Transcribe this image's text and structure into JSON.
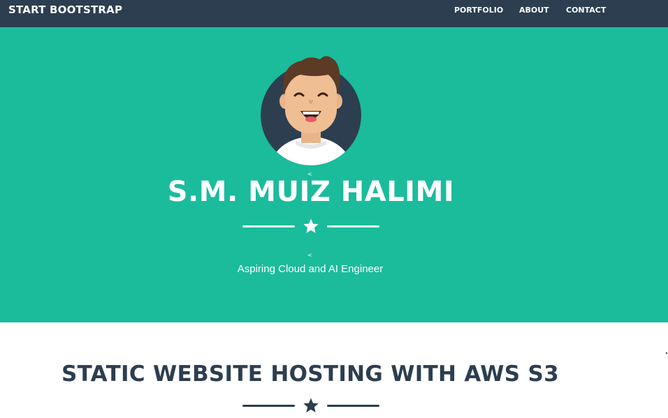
{
  "navbar": {
    "brand": "START BOOTSTRAP",
    "links": [
      {
        "label": "PORTFOLIO"
      },
      {
        "label": "ABOUT"
      },
      {
        "label": "CONTACT"
      }
    ]
  },
  "masthead": {
    "stray_mark": "<",
    "heading": "S.M. MUIZ HALIMI",
    "divider_icon": "star-icon",
    "subheading": "Aspiring Cloud and AI Engineer",
    "avatar_icon": "avatar-illustration"
  },
  "section": {
    "heading": "STATIC WEBSITE HOSTING WITH AWS S3",
    "divider_icon": "star-icon"
  },
  "colors": {
    "navbar": "#2c3e50",
    "masthead": "#1abc9c",
    "text_light": "#ffffff",
    "text_dark": "#2c3e50"
  }
}
